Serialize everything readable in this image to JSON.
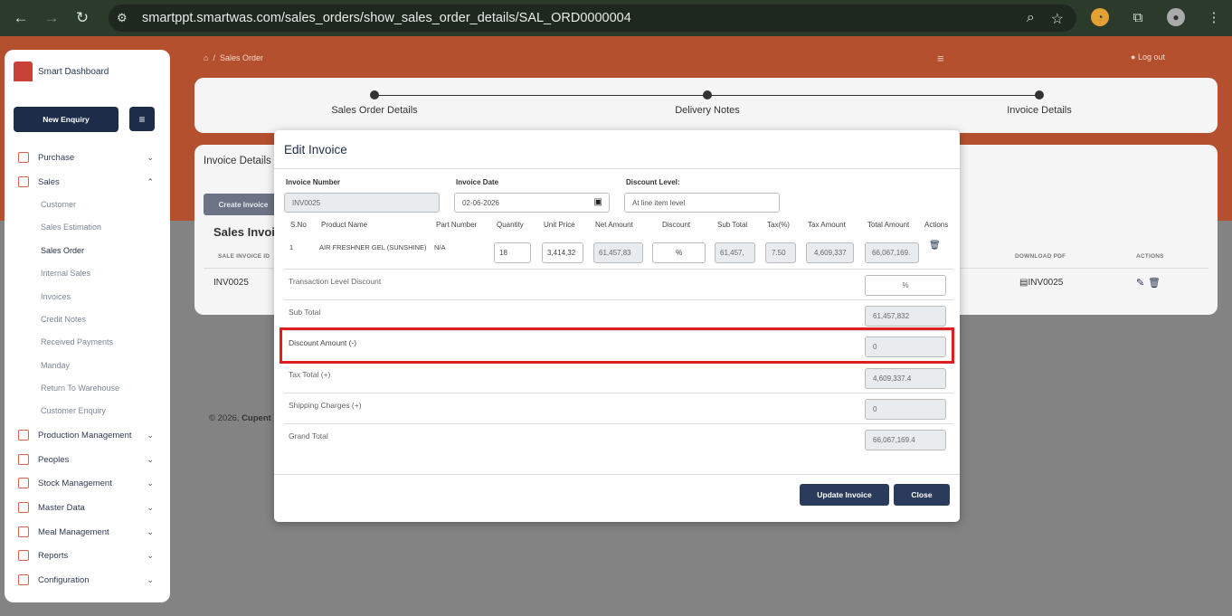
{
  "browser": {
    "url": "smartppt.smartwas.com/sales_orders/show_sales_order_details/SAL_ORD0000004"
  },
  "sidebar": {
    "brand": "Smart Dashboard",
    "new_enquiry": "New Enquiry",
    "menu": {
      "purchase": "Purchase",
      "sales": "Sales",
      "production": "Production Management",
      "peoples": "Peoples",
      "stock": "Stock Management",
      "master": "Master Data",
      "meal": "Meal Management",
      "reports": "Reports",
      "configuration": "Configuration"
    },
    "sales_sub": [
      "Customer",
      "Sales Estimation",
      "Sales Order",
      "Internal Sales",
      "Invoices",
      "Credit Notes",
      "Received Payments",
      "Manday",
      "Return To Warehouse",
      "Customer Enquiry"
    ]
  },
  "topbar": {
    "breadcrumb_sep": "/",
    "breadcrumb_page": "Sales Order",
    "logout": "Log out"
  },
  "stepper": {
    "steps": [
      "Sales Order Details",
      "Delivery Notes",
      "Invoice Details"
    ]
  },
  "invoice_section": {
    "title": "Invoice Details",
    "create_button": "Create Invoice",
    "list_title": "Sales Invoi",
    "columns": {
      "id": "SALE INVOICE ID",
      "download": "DOWNLOAD PDF",
      "actions": "ACTIONS"
    },
    "row": {
      "id": "INV0025",
      "pdf": "INV0025"
    }
  },
  "footer": {
    "text": "© 2026,",
    "company": "Cupent"
  },
  "modal": {
    "title": "Edit Invoice",
    "invoice_number_label": "Invoice Number",
    "invoice_number": "INV0025",
    "invoice_date_label": "Invoice Date",
    "invoice_date": "02-06-2026",
    "discount_level_label": "Discount Level:",
    "discount_level": "At line item level",
    "columns": [
      "S.No",
      "Product Name",
      "Part Number",
      "Quantity",
      "Unit Price",
      "Net Amount",
      "Discount",
      "Sub Total",
      "Tax(%)",
      "Tax Amount",
      "Total Amount",
      "Actions"
    ],
    "line": {
      "sno": "1",
      "product": "AIR FRESHNER GEL (SUNSHINE)",
      "part": "N/A",
      "quantity": "18",
      "unit_price": "3,414,32",
      "net_amount": "61,457,83",
      "discount": "%",
      "sub_total": "61,457,",
      "tax_pct": "7.50",
      "tax_amount": "4,609,337",
      "total_amount": "66,067,169."
    },
    "summary": {
      "transaction_discount_label": "Transaction Level Discount",
      "transaction_discount": "%",
      "sub_total_label": "Sub Total",
      "sub_total": "61,457,832",
      "discount_amount_label": "Discount Amount (-)",
      "discount_amount": "0",
      "tax_total_label": "Tax Total (+)",
      "tax_total": "4,609,337.4",
      "shipping_label": "Shipping Charges (+)",
      "shipping": "0",
      "grand_total_label": "Grand Total",
      "grand_total": "66,067,169.4"
    },
    "update_button": "Update Invoice",
    "close_button": "Close"
  },
  "colors": {
    "accent": "#b5502f",
    "navy": "#1d2c48",
    "highlight": "#dd1f1f"
  }
}
